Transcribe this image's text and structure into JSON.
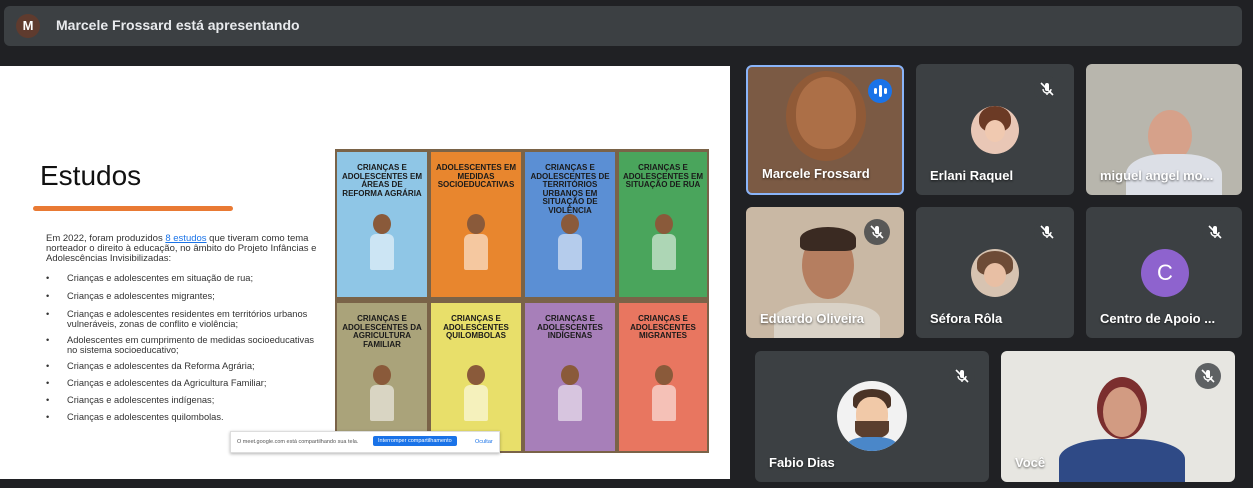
{
  "presenter_bar": {
    "avatar_letter": "M",
    "title": "Marcele Frossard está apresentando"
  },
  "slide": {
    "title": "Estudos",
    "intro_before": "Em 2022, foram produzidos ",
    "intro_link": "8 estudos",
    "intro_after": " que tiveram como tema norteador o direito à educação, no âmbito do Projeto Infâncias e Adolescências Invisibilizadas:",
    "bullet": "•",
    "bullets": [
      "Crianças e adolescentes em situação de rua;",
      "Crianças e adolescentes migrantes;",
      "Crianças e adolescentes residentes em territórios urbanos vulneráveis, zonas de conflito e violência;",
      "Adolescentes em cumprimento de medidas socioeducativas no sistema socioeducativo;",
      "Crianças e adolescentes da Reforma Agrária;",
      "Crianças e adolescentes da Agricultura Familiar;",
      "Crianças e adolescentes indígenas;",
      "Crianças e adolescentes quilombolas."
    ],
    "covers": [
      {
        "title": "CRIANÇAS E ADOLESCENTES EM ÁREAS DE REFORMA AGRÁRIA",
        "color": "#8fc6e6"
      },
      {
        "title": "ADOLESCENTES EM MEDIDAS SOCIOEDUCATIVAS",
        "color": "#e8862e"
      },
      {
        "title": "CRIANÇAS E ADOLESCENTES DE TERRITÓRIOS URBANOS EM SITUAÇÃO DE VIOLÊNCIA",
        "color": "#5b8fd4"
      },
      {
        "title": "CRIANÇAS E ADOLESCENTES EM SITUAÇÃO DE RUA",
        "color": "#4aa55c"
      },
      {
        "title": "CRIANÇAS E ADOLESCENTES DA AGRICULTURA FAMILIAR",
        "color": "#aaa37a"
      },
      {
        "title": "CRIANÇAS E ADOLESCENTES QUILOMBOLAS",
        "color": "#e8df6a"
      },
      {
        "title": "CRIANÇAS E ADOLESCENTES INDÍGENAS",
        "color": "#a77fb9"
      },
      {
        "title": "CRIANÇAS E ADOLESCENTES MIGRANTES",
        "color": "#e87660"
      }
    ],
    "share_bar": {
      "message": "O meet.google.com está compartilhando sua tela.",
      "stop_label": "Interromper compartilhamento",
      "hide_label": "Ocultar"
    }
  },
  "participants": [
    {
      "name": "Marcele Frossard",
      "muted": false,
      "speaking": true
    },
    {
      "name": "Erlani Raquel",
      "muted": true
    },
    {
      "name": "miguel angel mo...",
      "muted": false
    },
    {
      "name": "Eduardo Oliveira",
      "muted": true
    },
    {
      "name": "Séfora Rôla",
      "muted": true
    },
    {
      "name": "Centro de Apoio ...",
      "muted": true,
      "avatar_letter": "C",
      "avatar_color": "#8e63ce"
    },
    {
      "name": "Fabio Dias",
      "muted": true
    },
    {
      "name": "Você",
      "muted": true
    }
  ],
  "colors": {
    "background": "#202124",
    "tile": "#3c4043",
    "accent": "#1a73e8",
    "slide_underline": "#e97a34"
  }
}
